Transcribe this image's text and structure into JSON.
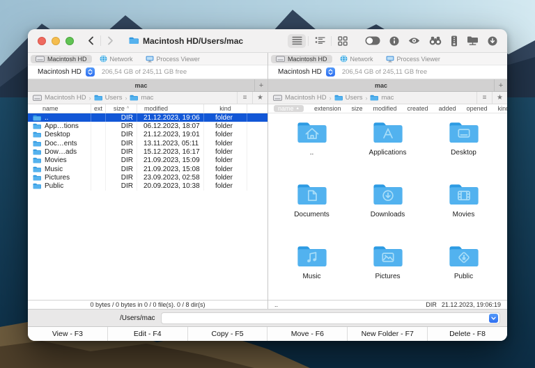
{
  "window": {
    "title": "Macintosh HD/Users/mac",
    "traffic_lights": [
      "close",
      "minimize",
      "zoom"
    ],
    "nav_icons": [
      "chevron-left-icon",
      "chevron-right-icon"
    ]
  },
  "toolbar": {
    "view_group": [
      "list-view-icon",
      "detail-view-icon",
      "grid-view-icon"
    ],
    "active_view": "list-view-icon",
    "action_icons": [
      "toggle-icon",
      "info-icon",
      "preview-eye-icon",
      "search-binoculars-icon",
      "archive-icon",
      "network-folder-icon",
      "download-icon"
    ]
  },
  "pane_tabs": [
    {
      "label": "Macintosh HD",
      "icon": "disk-icon",
      "active": true
    },
    {
      "label": "Network",
      "icon": "globe-icon",
      "active": false
    },
    {
      "label": "Process Viewer",
      "icon": "monitor-icon",
      "active": false
    }
  ],
  "drive": {
    "name": "Macintosh HD",
    "free": "206,54 GB of 245,11 GB free"
  },
  "left_pane": {
    "tab_title": "mac",
    "new_tab_label": "+",
    "breadcrumb": [
      "Macintosh HD",
      "Users",
      "mac"
    ],
    "columns": [
      {
        "label": "name"
      },
      {
        "label": "ext"
      },
      {
        "label": "size",
        "sort": "asc"
      },
      {
        "label": "modified"
      },
      {
        "label": "kind"
      }
    ],
    "rows": [
      {
        "name": "..",
        "ext": "",
        "size": "DIR",
        "modified": "21.12.2023, 19:06",
        "kind": "folder",
        "selected": true
      },
      {
        "name": "App…tions",
        "ext": "",
        "size": "DIR",
        "modified": "06.12.2023, 18:07",
        "kind": "folder",
        "selected": false
      },
      {
        "name": "Desktop",
        "ext": "",
        "size": "DIR",
        "modified": "21.12.2023, 19:01",
        "kind": "folder",
        "selected": false
      },
      {
        "name": "Doc…ents",
        "ext": "",
        "size": "DIR",
        "modified": "13.11.2023, 05:11",
        "kind": "folder",
        "selected": false
      },
      {
        "name": "Dow…ads",
        "ext": "",
        "size": "DIR",
        "modified": "15.12.2023, 16:17",
        "kind": "folder",
        "selected": false
      },
      {
        "name": "Movies",
        "ext": "",
        "size": "DIR",
        "modified": "21.09.2023, 15:09",
        "kind": "folder",
        "selected": false
      },
      {
        "name": "Music",
        "ext": "",
        "size": "DIR",
        "modified": "21.09.2023, 15:08",
        "kind": "folder",
        "selected": false
      },
      {
        "name": "Pictures",
        "ext": "",
        "size": "DIR",
        "modified": "23.09.2023, 02:58",
        "kind": "folder",
        "selected": false
      },
      {
        "name": "Public",
        "ext": "",
        "size": "DIR",
        "modified": "20.09.2023, 10:38",
        "kind": "folder",
        "selected": false
      }
    ],
    "status": "0 bytes / 0 bytes in 0 / 0 file(s). 0 / 8 dir(s)"
  },
  "right_pane": {
    "tab_title": "mac",
    "new_tab_label": "+",
    "breadcrumb": [
      "Macintosh HD",
      "Users",
      "mac"
    ],
    "columns": [
      {
        "label": "name",
        "sort": "asc"
      },
      {
        "label": "extension"
      },
      {
        "label": "size"
      },
      {
        "label": "modified"
      },
      {
        "label": "created"
      },
      {
        "label": "added"
      },
      {
        "label": "opened"
      },
      {
        "label": "kind"
      }
    ],
    "items": [
      {
        "label": "..",
        "glyph": "home"
      },
      {
        "label": "Applications",
        "glyph": "apps"
      },
      {
        "label": "Desktop",
        "glyph": "desktop"
      },
      {
        "label": "Documents",
        "glyph": "document"
      },
      {
        "label": "Downloads",
        "glyph": "download"
      },
      {
        "label": "Movies",
        "glyph": "movies"
      },
      {
        "label": "Music",
        "glyph": "music"
      },
      {
        "label": "Pictures",
        "glyph": "pictures"
      },
      {
        "label": "Public",
        "glyph": "public"
      }
    ],
    "status_left": "..",
    "status_right_size": "DIR",
    "status_right_date": "21.12.2023, 19:06:19"
  },
  "command_line": {
    "prompt": "/Users/mac",
    "value": ""
  },
  "function_bar": [
    {
      "label": "View - F3"
    },
    {
      "label": "Edit - F4"
    },
    {
      "label": "Copy - F5"
    },
    {
      "label": "Move - F6"
    },
    {
      "label": "New Folder - F7"
    },
    {
      "label": "Delete - F8"
    }
  ],
  "colors": {
    "selection": "#1257d6",
    "accent": "#3b82f7",
    "folder_blue": "#52b2ef",
    "tab_pill": "#dcdbdb"
  }
}
